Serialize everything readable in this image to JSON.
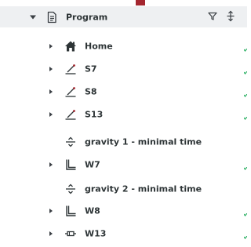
{
  "colors": {
    "accent": "#a4262f",
    "header_bg": "#eef0f2",
    "text": "#2d3436",
    "check": "#27ae60"
  },
  "header": {
    "title": "Program",
    "icon": "document-icon",
    "actions": [
      "filter-icon",
      "sort-icon"
    ]
  },
  "items": [
    {
      "label": "Home",
      "icon": "home-icon",
      "expandable": true
    },
    {
      "label": "S7",
      "icon": "linear-move-icon",
      "expandable": true
    },
    {
      "label": "S8",
      "icon": "linear-move-icon",
      "expandable": true
    },
    {
      "label": "S13",
      "icon": "linear-move-icon",
      "expandable": true
    },
    {
      "label": "gravity 1 - minimal time",
      "icon": "gravity-icon",
      "expandable": false
    },
    {
      "label": "W7",
      "icon": "corner-move-icon",
      "expandable": true
    },
    {
      "label": "gravity 2 - minimal time",
      "icon": "gravity-icon",
      "expandable": false
    },
    {
      "label": "W8",
      "icon": "corner-move-icon",
      "expandable": true
    },
    {
      "label": "W13",
      "icon": "gripper-icon",
      "expandable": true
    }
  ]
}
